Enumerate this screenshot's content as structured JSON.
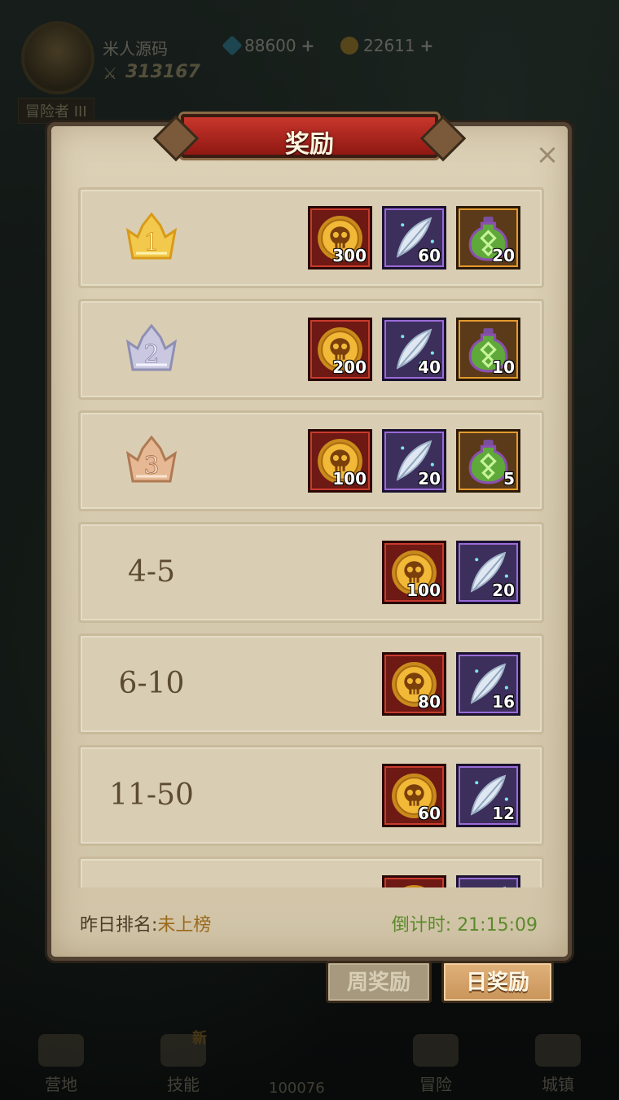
{
  "hud": {
    "player_name": "米人源码",
    "power": "313167",
    "rank_title": "冒险者 III",
    "gems": "88600",
    "coins": "22611",
    "plus": "+"
  },
  "nav": {
    "items": [
      "营地",
      "技能",
      "冒险",
      "城镇"
    ],
    "new_badge": "新",
    "center_value": "100076"
  },
  "modal": {
    "title": "奖励",
    "close": "×"
  },
  "rewards": [
    {
      "rank": "1",
      "items": [
        {
          "type": "coin",
          "qty": "300"
        },
        {
          "type": "feather",
          "qty": "60"
        },
        {
          "type": "potion",
          "qty": "20"
        }
      ]
    },
    {
      "rank": "2",
      "items": [
        {
          "type": "coin",
          "qty": "200"
        },
        {
          "type": "feather",
          "qty": "40"
        },
        {
          "type": "potion",
          "qty": "10"
        }
      ]
    },
    {
      "rank": "3",
      "items": [
        {
          "type": "coin",
          "qty": "100"
        },
        {
          "type": "feather",
          "qty": "20"
        },
        {
          "type": "potion",
          "qty": "5"
        }
      ]
    },
    {
      "rank": "4-5",
      "items": [
        {
          "type": "coin",
          "qty": "100"
        },
        {
          "type": "feather",
          "qty": "20"
        }
      ]
    },
    {
      "rank": "6-10",
      "items": [
        {
          "type": "coin",
          "qty": "80"
        },
        {
          "type": "feather",
          "qty": "16"
        }
      ]
    },
    {
      "rank": "11-50",
      "items": [
        {
          "type": "coin",
          "qty": "60"
        },
        {
          "type": "feather",
          "qty": "12"
        }
      ]
    },
    {
      "rank": "",
      "items": [
        {
          "type": "coin",
          "qty": ""
        },
        {
          "type": "feather",
          "qty": ""
        }
      ]
    }
  ],
  "footer": {
    "yesterday_label": "昨日排名:",
    "yesterday_value": "未上榜",
    "countdown_label": "倒计时: ",
    "countdown_value": "21:15:09"
  },
  "tabs": {
    "weekly": "周奖励",
    "daily": "日奖励",
    "active": "daily"
  },
  "colors": {
    "gold_badge": "#f2c94c",
    "silver_badge": "#c9c8e0",
    "bronze_badge": "#e6b994",
    "countdown": "#5b8a2b",
    "rank_value": "#9a6a1c"
  },
  "icons": {
    "coin": "skull-coin-icon",
    "feather": "feather-icon",
    "potion": "potion-icon",
    "close": "close-icon",
    "crown": "crown-icon"
  }
}
